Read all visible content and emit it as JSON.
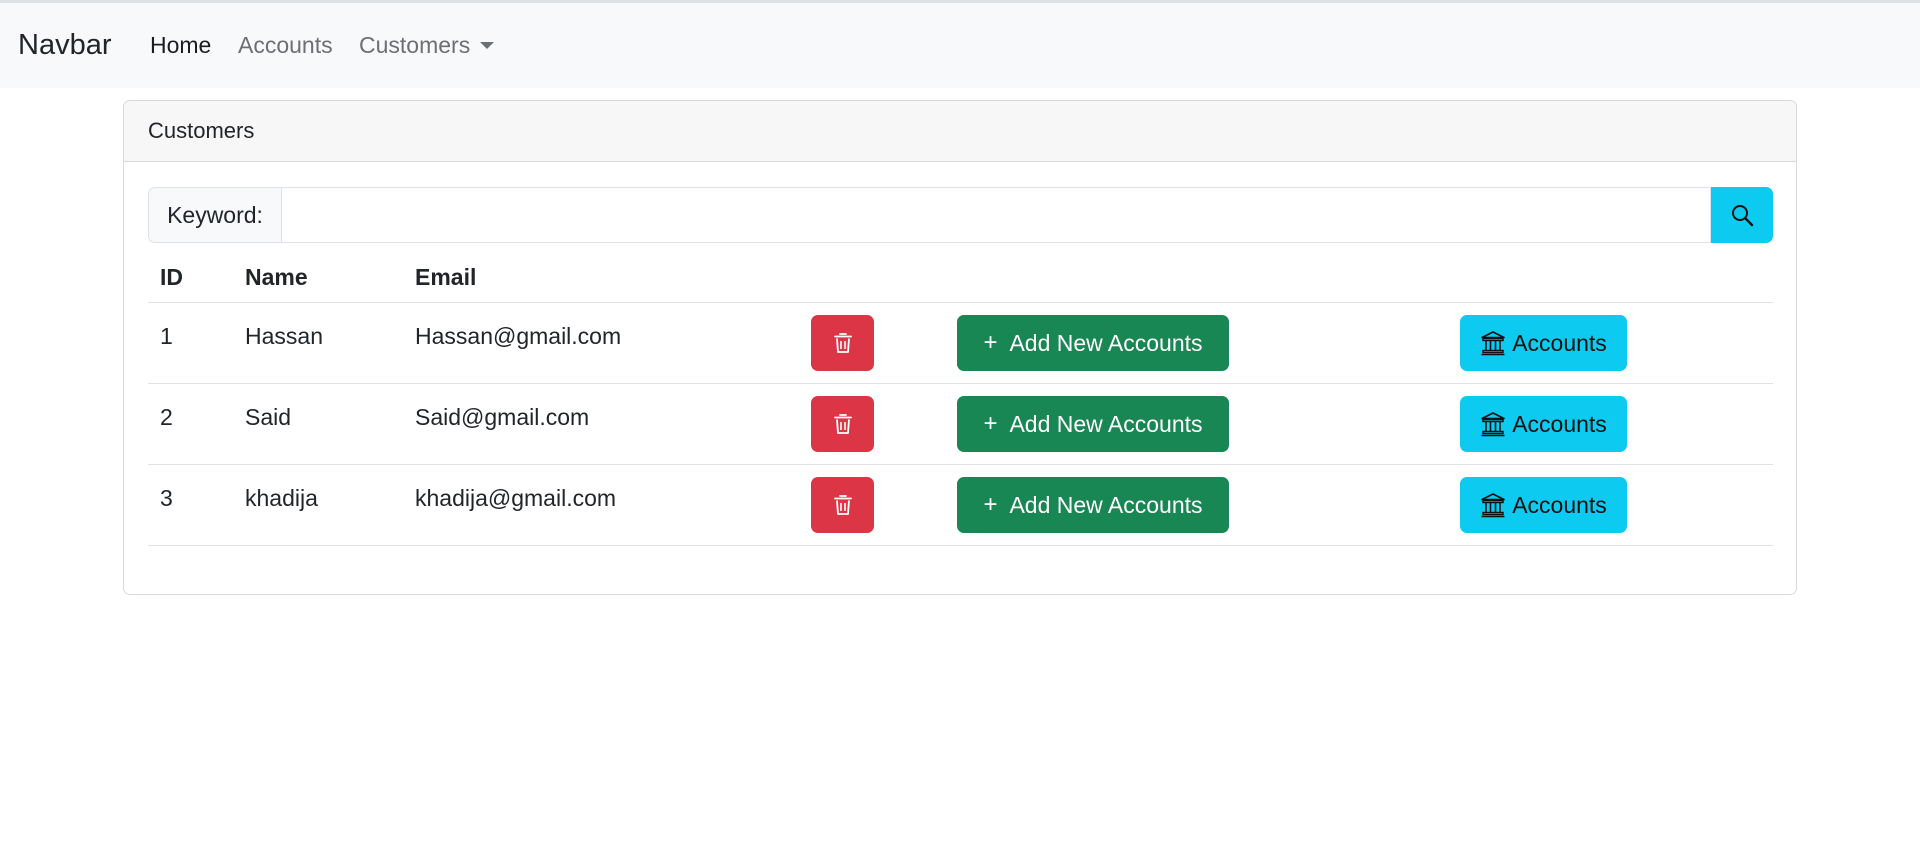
{
  "navbar": {
    "brand": "Navbar",
    "links": [
      {
        "label": "Home"
      },
      {
        "label": "Accounts"
      },
      {
        "label": "Customers"
      }
    ]
  },
  "card": {
    "title": "Customers",
    "search": {
      "label": "Keyword:",
      "value": "",
      "placeholder": "",
      "button_icon": "search-icon"
    },
    "table": {
      "headers": [
        "ID",
        "Name",
        "Email"
      ],
      "rows": [
        {
          "id": "1",
          "name": "Hassan",
          "email": "Hassan@gmail.com"
        },
        {
          "id": "2",
          "name": "Said",
          "email": "Said@gmail.com"
        },
        {
          "id": "3",
          "name": "khadija",
          "email": "khadija@gmail.com"
        }
      ],
      "add_label": "Add New Accounts",
      "accounts_label": "Accounts"
    }
  },
  "colors": {
    "navbar_bg": "#f8f9fa",
    "danger": "#dc3545",
    "success": "#198754",
    "info": "#0dcaf0"
  }
}
